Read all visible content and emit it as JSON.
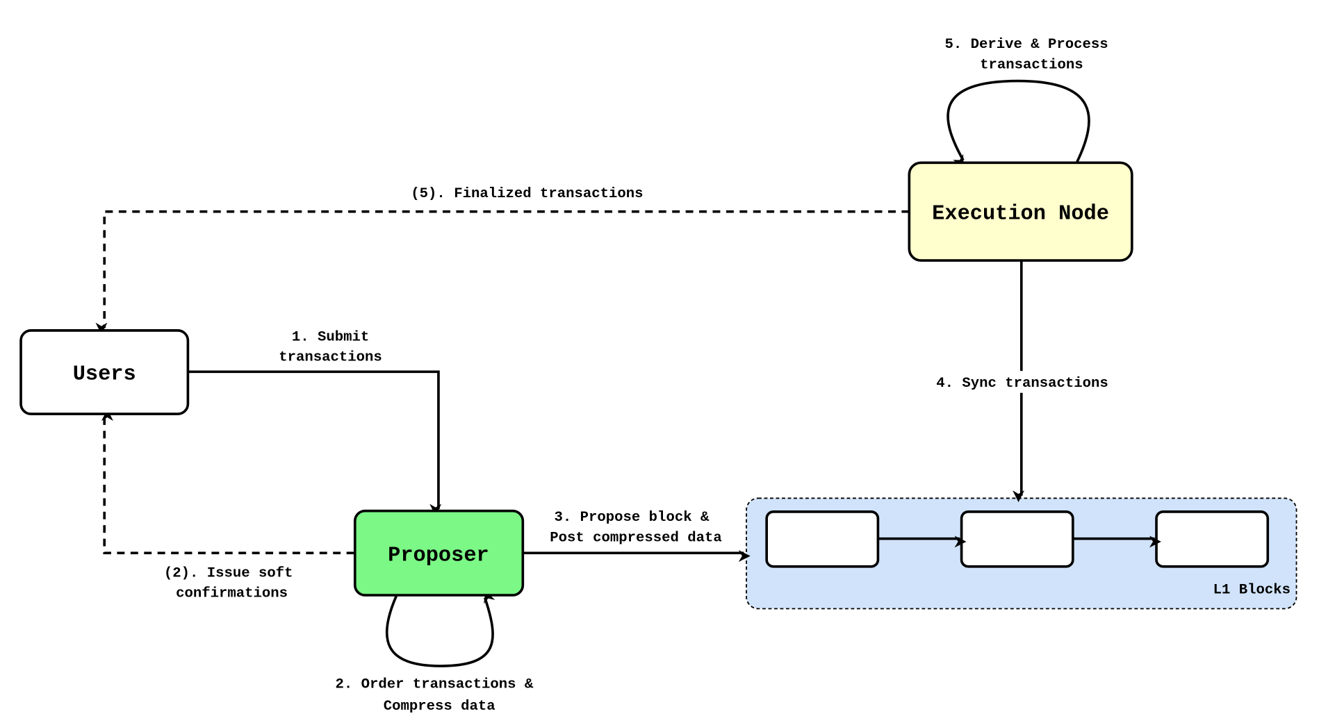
{
  "nodes": {
    "users": {
      "label": "Users",
      "fill": "#ffffff"
    },
    "proposer": {
      "label": "Proposer",
      "fill": "#7bf886"
    },
    "execution_node": {
      "label": "Execution Node",
      "fill": "#fffecd"
    },
    "l1_blocks": {
      "label": "L1 Blocks",
      "fill": "#d0e3fb"
    }
  },
  "edges": {
    "submit": [
      "1. Submit",
      "transactions"
    ],
    "order": [
      "2. Order transactions &",
      "Compress data"
    ],
    "soft_confirm": [
      "(2). Issue soft",
      "confirmations"
    ],
    "propose": [
      "3. Propose block &",
      "Post compressed data"
    ],
    "sync": "4. Sync transactions",
    "derive": [
      "5. Derive & Process",
      "transactions"
    ],
    "finalized": "(5). Finalized transactions"
  }
}
